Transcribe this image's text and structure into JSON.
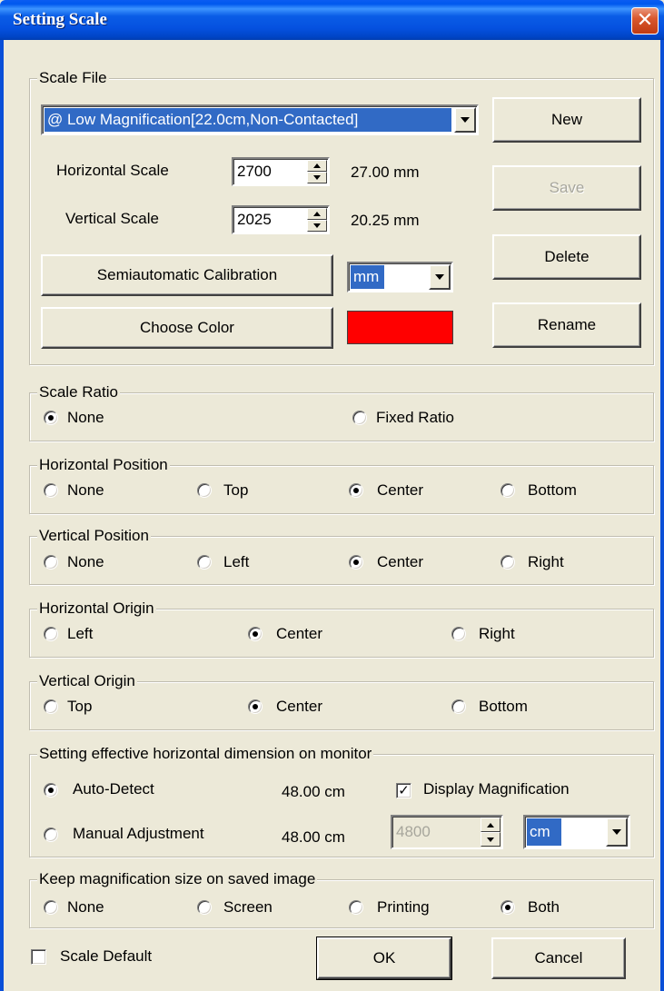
{
  "window": {
    "title": "Setting Scale",
    "close_glyph": "✕"
  },
  "scale_file": {
    "group_label": "Scale File",
    "selected_file": "@ Low Magnification[22.0cm,Non-Contacted]",
    "horizontal_label": "Horizontal Scale",
    "horizontal_value": "2700",
    "horizontal_mm": "27.00 mm",
    "vertical_label": "Vertical Scale",
    "vertical_value": "2025",
    "vertical_mm": "20.25 mm",
    "calibration_label": "Semiautomatic Calibration",
    "unit_value": "mm",
    "choose_color_label": "Choose Color",
    "color_value": "#FF0000",
    "new_label": "New",
    "save_label": "Save",
    "delete_label": "Delete",
    "rename_label": "Rename"
  },
  "scale_ratio": {
    "group_label": "Scale Ratio",
    "options": [
      "None",
      "Fixed Ratio"
    ],
    "selected": "None"
  },
  "horizontal_position": {
    "group_label": "Horizontal Position",
    "options": [
      "None",
      "Top",
      "Center",
      "Bottom"
    ],
    "selected": "Center"
  },
  "vertical_position": {
    "group_label": "Vertical Position",
    "options": [
      "None",
      "Left",
      "Center",
      "Right"
    ],
    "selected": "Center"
  },
  "horizontal_origin": {
    "group_label": "Horizontal Origin",
    "options": [
      "Left",
      "Center",
      "Right"
    ],
    "selected": "Center"
  },
  "vertical_origin": {
    "group_label": "Vertical Origin",
    "options": [
      "Top",
      "Center",
      "Bottom"
    ],
    "selected": "Center"
  },
  "monitor": {
    "group_label": "Setting effective horizontal dimension on monitor",
    "auto_detect_label": "Auto-Detect",
    "auto_detect_value": "48.00 cm",
    "display_magnification_label": "Display Magnification",
    "display_magnification_checked": true,
    "check_glyph": "✓",
    "manual_label": "Manual Adjustment",
    "manual_value": "48.00 cm",
    "manual_spin_value": "4800",
    "manual_unit": "cm",
    "selected": "Auto-Detect"
  },
  "keep_magnification": {
    "group_label": "Keep magnification size on saved image",
    "options": [
      "None",
      "Screen",
      "Printing",
      "Both"
    ],
    "selected": "Both"
  },
  "footer": {
    "scale_default_label": "Scale Default",
    "scale_default_checked": false,
    "ok_label": "OK",
    "cancel_label": "Cancel"
  }
}
